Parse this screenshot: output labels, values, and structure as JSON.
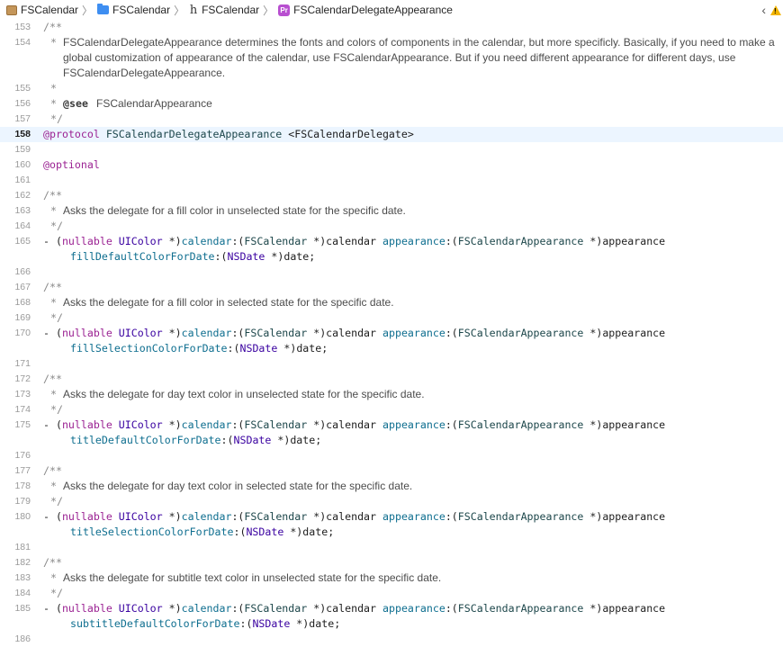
{
  "breadcrumbs": {
    "project": "FSCalendar",
    "group": "FSCalendar",
    "file": "FSCalendar",
    "symbol": "FSCalendarDelegateAppearance",
    "symbol_badge": "Pr"
  },
  "icons": {
    "project": "package-icon",
    "group": "folder-icon",
    "file": "header-file-icon",
    "symbol": "protocol-icon",
    "back": "chevron-left-icon",
    "warning": "warning-icon"
  },
  "colors": {
    "keyword": "#9b2393",
    "type": "#3900a0",
    "selector": "#0e6e8f",
    "comment": "#8a8a8a",
    "highlight": "#ecf5ff",
    "warning": "#f2b400",
    "protocol_badge": "#b84fd0"
  },
  "code": {
    "current_line": "158",
    "lines": {
      "l153": {
        "num": "153",
        "comment": "/**"
      },
      "l154": {
        "num": "154",
        "star": "*",
        "text": "FSCalendarDelegateAppearance determines the fonts and colors of components in the calendar, but more specificly. Basically, if you need to make a global customization of appearance of the calendar, use FSCalendarAppearance. But if you need different appearance for different days, use FSCalendarDelegateAppearance."
      },
      "l155": {
        "num": "155",
        "star": "*"
      },
      "l156": {
        "num": "156",
        "star": "*",
        "tag": "@see",
        "text": "FSCalendarAppearance"
      },
      "l157": {
        "num": "157",
        "comment": "*/"
      },
      "l158": {
        "num": "158",
        "kw": "@protocol",
        "name": "FSCalendarDelegateAppearance",
        "conform": "<FSCalendarDelegate>"
      },
      "l159": {
        "num": "159"
      },
      "l160": {
        "num": "160",
        "kw": "@optional"
      },
      "l161": {
        "num": "161"
      },
      "l162": {
        "num": "162",
        "comment": "/**"
      },
      "l163": {
        "num": "163",
        "star": "*",
        "text": "Asks the delegate for a fill color in unselected state for the specific date."
      },
      "l164": {
        "num": "164",
        "comment": "*/"
      },
      "l165": {
        "num": "165",
        "sel2": "fillDefaultColorForDate"
      },
      "l166": {
        "num": "166"
      },
      "l167": {
        "num": "167",
        "comment": "/**"
      },
      "l168": {
        "num": "168",
        "star": "*",
        "text": "Asks the delegate for a fill color in selected state for the specific date."
      },
      "l169": {
        "num": "169",
        "comment": "*/"
      },
      "l170": {
        "num": "170",
        "sel2": "fillSelectionColorForDate"
      },
      "l171": {
        "num": "171"
      },
      "l172": {
        "num": "172",
        "comment": "/**"
      },
      "l173": {
        "num": "173",
        "star": "*",
        "text": "Asks the delegate for day text color in unselected state for the specific date."
      },
      "l174": {
        "num": "174",
        "comment": "*/"
      },
      "l175": {
        "num": "175",
        "sel2": "titleDefaultColorForDate"
      },
      "l176": {
        "num": "176"
      },
      "l177": {
        "num": "177",
        "comment": "/**"
      },
      "l178": {
        "num": "178",
        "star": "*",
        "text": "Asks the delegate for day text color in selected state for the specific date."
      },
      "l179": {
        "num": "179",
        "comment": "*/"
      },
      "l180": {
        "num": "180",
        "sel2": "titleSelectionColorForDate"
      },
      "l181": {
        "num": "181"
      },
      "l182": {
        "num": "182",
        "comment": "/**"
      },
      "l183": {
        "num": "183",
        "star": "*",
        "text": "Asks the delegate for subtitle text color in unselected state for the specific date."
      },
      "l184": {
        "num": "184",
        "comment": "*/"
      },
      "l185": {
        "num": "185",
        "sel2": "subtitleDefaultColorForDate"
      },
      "l186": {
        "num": "186"
      }
    },
    "method": {
      "dash": "-",
      "lparen": "(",
      "nullable": "nullable",
      "uicolor": "UIColor",
      "ret_tail": " *)",
      "sel1": "calendar",
      "colon1": ":(",
      "fscal": "FSCalendar",
      "arg1": " *)calendar ",
      "sel_app": "appearance",
      "colon2": ":(",
      "fsapp": "FSCalendarAppearance",
      "arg2": " *)appearance",
      "colon3": ":(",
      "nsdate": "NSDate",
      "arg3": " *)date;"
    }
  }
}
